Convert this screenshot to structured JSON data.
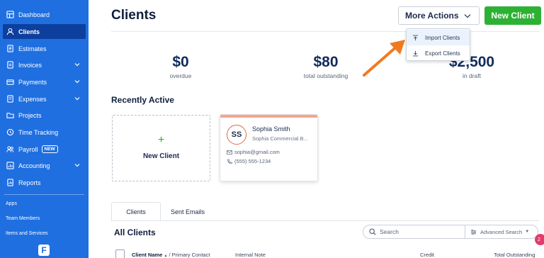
{
  "sidebar": {
    "items": [
      {
        "label": "Dashboard",
        "icon": "dashboard-icon"
      },
      {
        "label": "Clients",
        "icon": "clients-icon",
        "active": true
      },
      {
        "label": "Estimates",
        "icon": "estimates-icon"
      },
      {
        "label": "Invoices",
        "icon": "invoices-icon",
        "expandable": true
      },
      {
        "label": "Payments",
        "icon": "payments-icon",
        "expandable": true
      },
      {
        "label": "Expenses",
        "icon": "expenses-icon",
        "expandable": true
      },
      {
        "label": "Projects",
        "icon": "projects-icon"
      },
      {
        "label": "Time Tracking",
        "icon": "clock-icon"
      },
      {
        "label": "Payroll",
        "icon": "payroll-icon",
        "badge": "NEW"
      },
      {
        "label": "Accounting",
        "icon": "accounting-icon",
        "expandable": true
      },
      {
        "label": "Reports",
        "icon": "reports-icon"
      }
    ],
    "secondary": [
      "Apps",
      "Team Members",
      "Items and Services"
    ],
    "logo_letter": "F"
  },
  "header": {
    "title": "Clients",
    "more_actions": "More Actions",
    "new_client": "New Client"
  },
  "dropdown": {
    "items": [
      {
        "label": "Import Clients",
        "icon": "upload-icon"
      },
      {
        "label": "Export Clients",
        "icon": "download-icon"
      }
    ]
  },
  "stats": [
    {
      "value": "$0",
      "label": "overdue"
    },
    {
      "value": "$80",
      "label": "total outstanding"
    },
    {
      "value": "$2,500",
      "label": "in draft"
    }
  ],
  "recent": {
    "title": "Recently Active",
    "new_client_plus": "+",
    "new_client_label": "New Client",
    "client": {
      "initials": "SS",
      "name": "Sophia Smith",
      "org": "Sophia Commercial B...",
      "email": "sophia@gmail.com",
      "phone": "(555) 555-1234"
    }
  },
  "tabs": [
    "Clients",
    "Sent Emails"
  ],
  "list": {
    "title": "All Clients",
    "search_placeholder": "Search",
    "advanced_search": "Advanced Search",
    "notification_count": "2",
    "columns": {
      "client_name": "Client Name",
      "sort_indicator": "▲",
      "primary_contact": "/ Primary Contact",
      "internal_note": "Internal Note",
      "credit": "Credit",
      "total_outstanding": "Total Outstanding"
    }
  },
  "colors": {
    "sidebar": "#1f6fe0",
    "sidebar_active": "#0d3f9e",
    "primary_green": "#2db134",
    "arrow": "#f07a22",
    "navy": "#0f2c5c"
  }
}
